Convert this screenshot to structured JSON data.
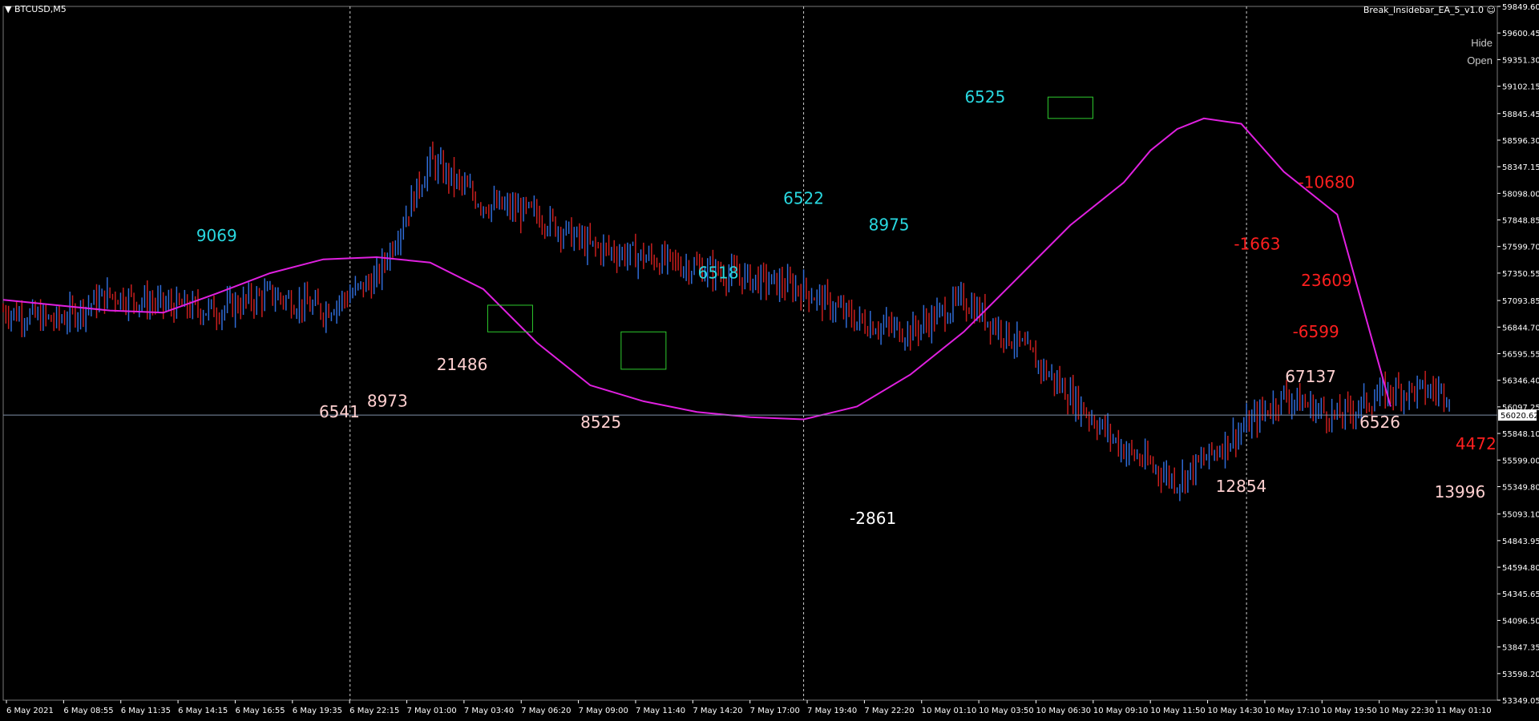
{
  "window": {
    "symbol_title": "BTCUSD,M5",
    "ea_name": "Break_Insidebar_EA_5_v1.0",
    "hide_label": "Hide",
    "open_label": "Open"
  },
  "colors": {
    "background": "#000000",
    "axis_text": "#ffffff",
    "bull_candle": "#2f6bd6",
    "bear_candle": "#c81e1e",
    "inside_bar_box": "#2ecc2e",
    "moving_average": "#e020e0",
    "current_price_line": "#7f8fa8",
    "separator": "#ffffff",
    "trade_bull": "#29d8e0",
    "trade_bear": "#ff1f1f",
    "trade_neutral": "#ffd0d0",
    "neutral_white": "#ffffff"
  },
  "chart_data": {
    "type": "candlestick",
    "symbol": "BTCUSD",
    "timeframe": "M5",
    "ylim": [
      53349.05,
      59849.6
    ],
    "grid": false,
    "current_price": 56020.62,
    "y_ticks": [
      "59849.60",
      "59600.45",
      "59351.30",
      "59102.15",
      "58845.45",
      "58596.30",
      "58347.15",
      "58098.00",
      "57848.85",
      "57599.70",
      "57350.55",
      "57093.85",
      "56844.70",
      "56595.55",
      "56346.40",
      "56097.25",
      "55848.10",
      "55599.00",
      "55349.80",
      "55093.10",
      "54843.95",
      "54594.80",
      "54345.65",
      "54096.50",
      "53847.35",
      "53598.20",
      "53349.05"
    ],
    "x_ticks": [
      "6 May 2021",
      "6 May 08:55",
      "6 May 11:35",
      "6 May 14:15",
      "6 May 16:55",
      "6 May 19:35",
      "6 May 22:15",
      "7 May 01:00",
      "7 May 03:40",
      "7 May 06:20",
      "7 May 09:00",
      "7 May 11:40",
      "7 May 14:20",
      "7 May 17:00",
      "7 May 19:40",
      "7 May 22:20",
      "10 May 01:10",
      "10 May 03:50",
      "10 May 06:30",
      "10 May 09:10",
      "10 May 11:50",
      "10 May 14:30",
      "10 May 17:10",
      "10 May 19:50",
      "10 May 22:30",
      "11 May 01:10"
    ],
    "close_path": {
      "x": [
        0,
        10,
        20,
        30,
        40,
        50,
        60,
        70,
        80,
        90,
        100,
        110,
        120,
        130,
        140,
        150,
        160,
        170,
        180,
        190,
        200,
        210,
        220,
        230,
        240,
        250,
        260
      ],
      "close": [
        57000,
        56900,
        57150,
        57050,
        57000,
        57150,
        57000,
        57300,
        58400,
        58000,
        57900,
        57600,
        57500,
        57400,
        57300,
        57200,
        56900,
        56800,
        57100,
        56700,
        56200,
        55700,
        55400,
        55800,
        56200,
        56000,
        56250
      ]
    },
    "moving_average": {
      "x": [
        0,
        20,
        30,
        40,
        50,
        60,
        70,
        80,
        90,
        100,
        110,
        120,
        130,
        140,
        150,
        160,
        170,
        180,
        190,
        200,
        210,
        215,
        220,
        225,
        232,
        240,
        250,
        260
      ],
      "y": [
        57100,
        57000,
        56980,
        57160,
        57350,
        57480,
        57500,
        57450,
        57200,
        56700,
        56300,
        56150,
        56050,
        56000,
        55980,
        56100,
        56400,
        56800,
        57300,
        57800,
        58200,
        58500,
        58700,
        58800,
        58750,
        58300,
        57900,
        56100
      ]
    },
    "inside_bar_boxes": [
      {
        "x": 120,
        "high": 56800,
        "low": 56450,
        "color": "green"
      },
      {
        "x": 200,
        "high": 59000,
        "low": 58800,
        "color": "green"
      },
      {
        "x": 95,
        "high": 57050,
        "low": 56800,
        "color": "green"
      }
    ],
    "trade_labels": [
      {
        "text": "9069",
        "x": 40,
        "y": 57650,
        "color": "bull"
      },
      {
        "text": "6541",
        "x": 63,
        "y": 56000,
        "color": "neutral"
      },
      {
        "text": "8973",
        "x": 72,
        "y": 56100,
        "color": "neutral"
      },
      {
        "text": "21486",
        "x": 86,
        "y": 56440,
        "color": "neutral"
      },
      {
        "text": "8525",
        "x": 112,
        "y": 55900,
        "color": "neutral"
      },
      {
        "text": "6518",
        "x": 134,
        "y": 57300,
        "color": "bull"
      },
      {
        "text": "6522",
        "x": 150,
        "y": 58000,
        "color": "bull"
      },
      {
        "text": "8975",
        "x": 166,
        "y": 57750,
        "color": "bull"
      },
      {
        "text": "-2861",
        "x": 163,
        "y": 55000,
        "color": "neutral_white"
      },
      {
        "text": "6525",
        "x": 184,
        "y": 58950,
        "color": "bull"
      },
      {
        "text": "12854",
        "x": 232,
        "y": 55300,
        "color": "neutral"
      },
      {
        "text": "-1663",
        "x": 235,
        "y": 57570,
        "color": "bear"
      },
      {
        "text": "-10680",
        "x": 248,
        "y": 58150,
        "color": "bear"
      },
      {
        "text": "23609",
        "x": 248,
        "y": 57230,
        "color": "bear"
      },
      {
        "text": "-6599",
        "x": 246,
        "y": 56750,
        "color": "bear"
      },
      {
        "text": "67137",
        "x": 245,
        "y": 56330,
        "color": "neutral"
      },
      {
        "text": "6526",
        "x": 258,
        "y": 55900,
        "color": "neutral"
      },
      {
        "text": "13996",
        "x": 273,
        "y": 55250,
        "color": "neutral"
      },
      {
        "text": "4472",
        "x": 276,
        "y": 55700,
        "color": "bear"
      }
    ]
  }
}
